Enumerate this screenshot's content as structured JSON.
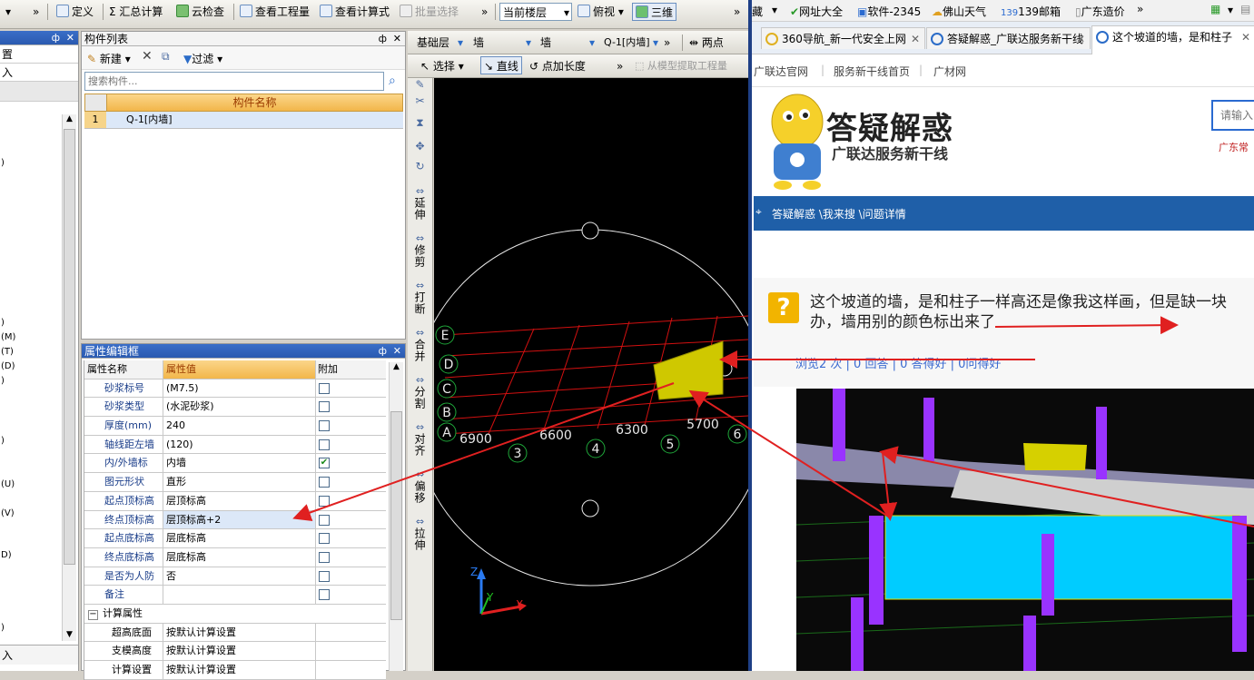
{
  "toolbar": {
    "define": "定义",
    "sum_calc": "Σ 汇总计算",
    "cloud_check": "云检查",
    "view_qty": "查看工程量",
    "view_formula": "查看计算式",
    "batch_select": "批量选择",
    "current_floor": "当前楼层",
    "top_view": "俯视",
    "three_d": "三维"
  },
  "second_toolbar": {
    "floor": "基础层",
    "type1": "墙",
    "type2": "墙",
    "component": "Q-1[内墙]",
    "two_point": "两点",
    "select": "选择",
    "line": "直线",
    "point_length": "点加长度",
    "extract": "从模型提取工程量"
  },
  "left_panel": {
    "item1": "置",
    "item2": "入",
    "labels": [
      ")",
      ")",
      "(M)",
      "(T)",
      "(D)",
      ")",
      ")",
      "(U)",
      "(V)",
      "D)",
      ")"
    ],
    "bottom": "入"
  },
  "component_list": {
    "title": "构件列表",
    "new": "新建",
    "filter": "过滤",
    "search_placeholder": "搜索构件...",
    "col_name": "构件名称",
    "rows": [
      {
        "idx": "1",
        "name": "Q-1[内墙]"
      }
    ]
  },
  "property_editor": {
    "title": "属性编辑框",
    "col_name": "属性名称",
    "col_value": "属性值",
    "col_extra": "附加",
    "rows": [
      {
        "name": "砂浆标号",
        "value": "(M7.5)",
        "checked": false
      },
      {
        "name": "砂浆类型",
        "value": "(水泥砂浆)",
        "checked": false
      },
      {
        "name": "厚度(mm)",
        "value": "240",
        "checked": false
      },
      {
        "name": "轴线距左墙",
        "value": "(120)",
        "checked": false
      },
      {
        "name": "内/外墙标",
        "value": "内墙",
        "checked": true
      },
      {
        "name": "图元形状",
        "value": "直形",
        "checked": false
      },
      {
        "name": "起点顶标高",
        "value": "层顶标高",
        "checked": false
      },
      {
        "name": "终点顶标高",
        "value": "层顶标高+2",
        "checked": false
      },
      {
        "name": "起点底标高",
        "value": "层底标高",
        "checked": false
      },
      {
        "name": "终点底标高",
        "value": "层底标高",
        "checked": false
      },
      {
        "name": "是否为人防",
        "value": "否",
        "checked": false
      },
      {
        "name": "备注",
        "value": "",
        "checked": false
      }
    ],
    "group": "计算属性",
    "sub_rows": [
      {
        "name": "超高底面",
        "value": "按默认计算设置"
      },
      {
        "name": "支模高度",
        "value": "按默认计算设置"
      },
      {
        "name": "计算设置",
        "value": "按默认计算设置"
      }
    ]
  },
  "vertical_tools": [
    "延伸",
    "修剪",
    "打断",
    "合并",
    "分割",
    "对齐",
    "偏移",
    "拉伸"
  ],
  "canvas": {
    "axis_rows": [
      "E",
      "D",
      "C",
      "B",
      "A"
    ],
    "axis_cols": [
      "3",
      "4",
      "5",
      "6"
    ],
    "dims": [
      "6900",
      "6600",
      "6300",
      "5700"
    ],
    "axis_z": "Z",
    "axis_y": "Y",
    "axis_x": "X"
  },
  "browser": {
    "bookmarks": [
      "藏",
      "网址大全",
      "软件-2345",
      "佛山天气",
      "139邮箱",
      "广东造价"
    ],
    "tabs": [
      "360导航_新一代安全上网",
      "答疑解惑_广联达服务新干线",
      "这个坡道的墙，是和柱子"
    ],
    "nav_links": [
      "广联达官网",
      "服务新干线首页",
      "广材网"
    ],
    "logo_title": "答疑解惑",
    "logo_sub": "广联达服务新干线",
    "search_placeholder": "请输入",
    "region": "广东常",
    "breadcrumb": "答疑解惑 \\我来搜 \\问题详情",
    "question_line1": "这个坡道的墙，是和柱子一样高还是像我这样画，但是缺一块",
    "question_line2": "办，墙用别的颜色标出来了",
    "stats": "浏览2 次 | 0 回答 | 0 答得好 | 0问得好"
  },
  "colors": {
    "red": "#e02020",
    "yellow": "#d6d000",
    "cyan": "#00ccff",
    "purple": "#9933ff",
    "blue_bar": "#1f5fa8"
  }
}
